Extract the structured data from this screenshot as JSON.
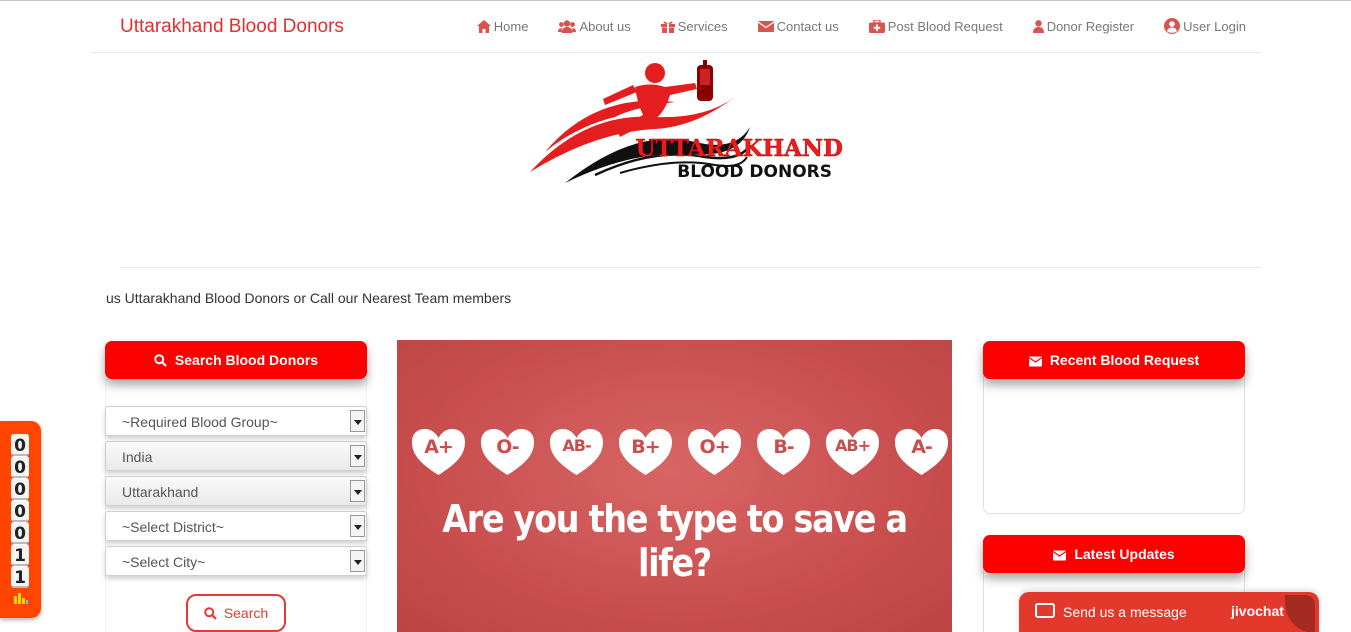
{
  "brand": "Uttarakhand Blood Donors",
  "nav": [
    {
      "label": "Home",
      "icon": "home-icon"
    },
    {
      "label": "About us",
      "icon": "users-icon"
    },
    {
      "label": "Services",
      "icon": "gift-icon"
    },
    {
      "label": "Contact us",
      "icon": "envelope-icon"
    },
    {
      "label": "Post Blood Request",
      "icon": "medkit-icon"
    },
    {
      "label": "Donor Register",
      "icon": "user-icon"
    },
    {
      "label": "User Login",
      "icon": "user-circle-icon"
    }
  ],
  "logo": {
    "line1": "UTTARAKHAND",
    "line2": "BLOOD DONORS"
  },
  "marquee": "us Uttarakhand Blood Donors or Call our Nearest Team members",
  "search_panel": {
    "title": "Search Blood Donors",
    "selects": [
      {
        "value": "~Required Blood Group~"
      },
      {
        "value": "India"
      },
      {
        "value": "Uttarakhand"
      },
      {
        "value": "~Select District~"
      },
      {
        "value": "~Select City~"
      }
    ],
    "button": "Search"
  },
  "banner": {
    "blood_types": [
      "A+",
      "O-",
      "AB-",
      "B+",
      "O+",
      "B-",
      "AB+",
      "A-"
    ],
    "tagline": "Are you the type to save a life?"
  },
  "recent_requests": {
    "title": "Recent Blood Request"
  },
  "latest_updates": {
    "title": "Latest Updates"
  },
  "counter": {
    "digits": [
      "0",
      "0",
      "0",
      "0",
      "0",
      "1",
      "1"
    ]
  },
  "chat": {
    "message": "Send us a message",
    "brand": "jivochat"
  },
  "colors": {
    "accent": "#fd0000",
    "brand_text": "#e0312f",
    "banner": "#c94f4f",
    "chat": "#e3392d",
    "counter": "#ff4500"
  }
}
